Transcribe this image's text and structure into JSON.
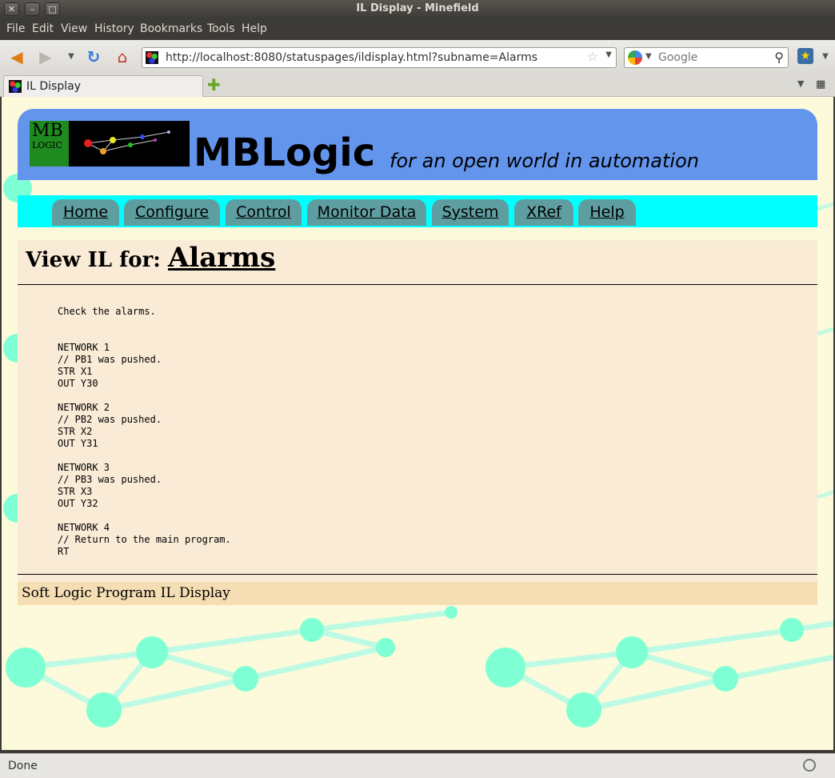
{
  "window": {
    "title": "IL Display - Minefield",
    "buttons": {
      "close": "✕",
      "minimize": "–",
      "maximize": "□"
    }
  },
  "menu": {
    "items": [
      "File",
      "Edit",
      "View",
      "History",
      "Bookmarks",
      "Tools",
      "Help"
    ]
  },
  "toolbar": {
    "url": "http://localhost:8080/statuspages/ildisplay.html?subname=Alarms",
    "search_placeholder": "Google"
  },
  "tabs": [
    {
      "label": "IL Display"
    }
  ],
  "page": {
    "site_name": "MBLogic",
    "tagline": "for an open world in automation",
    "logo": {
      "line1": "MB",
      "line2": "LOGIC"
    },
    "nav": [
      "Home",
      "Configure",
      "Control",
      "Monitor Data",
      "System",
      "XRef",
      "Help"
    ],
    "title_prefix": "View IL for:",
    "title_subroutine": "Alarms",
    "code": "Check the alarms.\n\n\nNETWORK 1\n// PB1 was pushed.\nSTR X1\nOUT Y30\n\nNETWORK 2\n// PB2 was pushed.\nSTR X2\nOUT Y31\n\nNETWORK 3\n// PB3 was pushed.\nSTR X3\nOUT Y32\n\nNETWORK 4\n// Return to the main program.\nRT",
    "footer": "Soft Logic Program IL Display"
  },
  "status": {
    "text": "Done"
  },
  "colors": {
    "header": "#6495ed",
    "nav_strip": "#00ffff",
    "nav_tab": "#5f9ea0",
    "content_bg": "#faebd7",
    "footer_bg": "#f5deb3",
    "page_bg": "#fdfadb",
    "network_decor": "#7fffd4"
  }
}
